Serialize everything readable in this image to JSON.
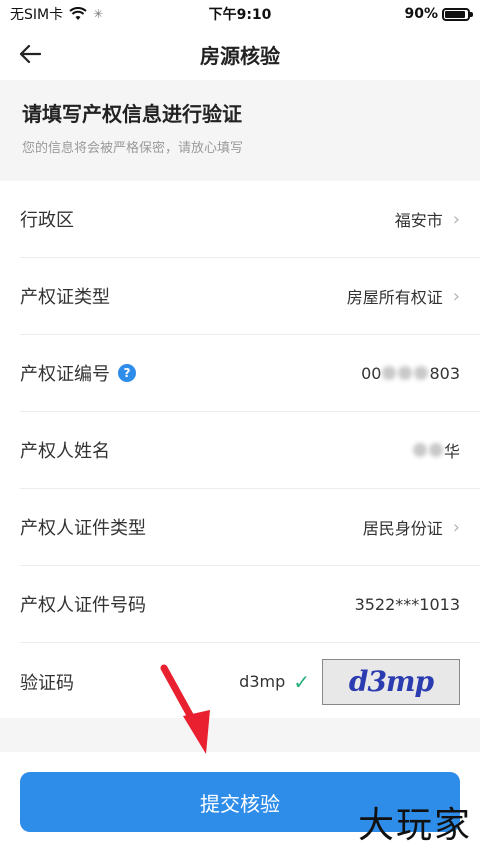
{
  "status_bar": {
    "carrier": "无SIM卡",
    "time": "下午9:10",
    "battery": "90%",
    "battery_level": 0.9
  },
  "nav": {
    "title": "房源核验"
  },
  "intro": {
    "title": "请填写产权信息进行验证",
    "subtitle": "您的信息将会被严格保密，请放心填写"
  },
  "form": {
    "district": {
      "label": "行政区",
      "value": "福安市"
    },
    "cert_type": {
      "label": "产权证类型",
      "value": "房屋所有权证"
    },
    "cert_no": {
      "label": "产权证编号",
      "value_prefix": "00",
      "value_suffix": "803"
    },
    "owner_name": {
      "label": "产权人姓名",
      "value_suffix": "华"
    },
    "id_type": {
      "label": "产权人证件类型",
      "value": "居民身份证"
    },
    "id_no": {
      "label": "产权人证件号码",
      "value": "3522***1013"
    },
    "captcha": {
      "label": "验证码",
      "value": "d3mp",
      "image_text": "d3mp"
    }
  },
  "submit": {
    "label": "提交核验"
  },
  "watermark": {
    "text": "大玩家"
  },
  "icons": {
    "back": "back-arrow-icon",
    "chevron": "chevron-right-icon",
    "help": "help-icon",
    "check": "check-icon",
    "wifi": "wifi-icon",
    "battery": "battery-icon"
  },
  "colors": {
    "primary": "#2f8dea",
    "check": "#28b07a",
    "arrow": "#e8202f"
  }
}
